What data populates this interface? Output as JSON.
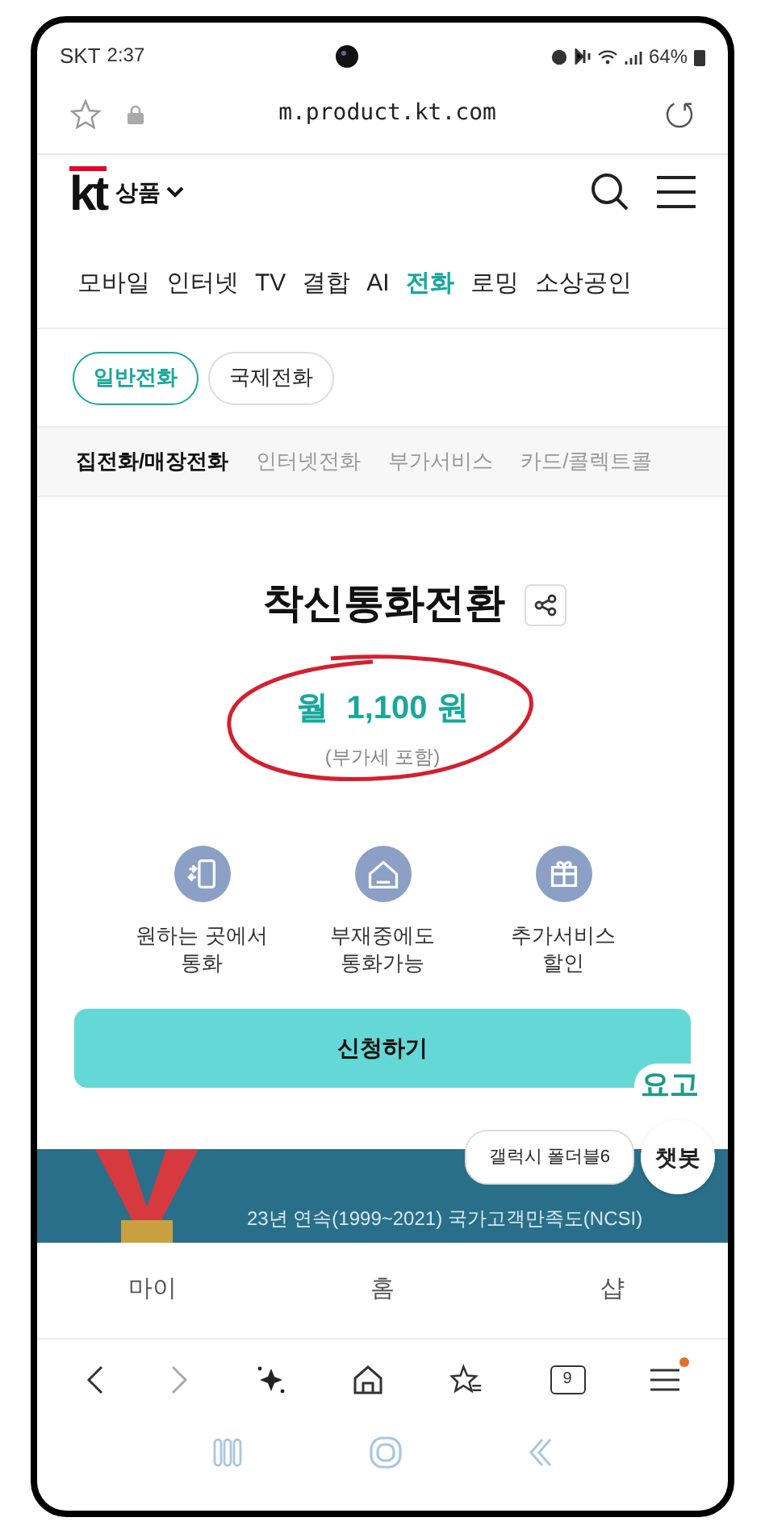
{
  "status_bar": {
    "carrier": "SKT",
    "time": "2:37",
    "battery": "64%"
  },
  "address_bar": {
    "url": "m.product.kt.com"
  },
  "header": {
    "logo": "kt",
    "menu_label": "상품"
  },
  "categories": [
    {
      "label": "모바일",
      "selected": false
    },
    {
      "label": "인터넷",
      "selected": false
    },
    {
      "label": "TV",
      "selected": false
    },
    {
      "label": "결합",
      "selected": false
    },
    {
      "label": "AI",
      "selected": false
    },
    {
      "label": "전화",
      "selected": true
    },
    {
      "label": "로밍",
      "selected": false
    },
    {
      "label": "소상공인",
      "selected": false
    }
  ],
  "chips": [
    {
      "label": "일반전화",
      "selected": true
    },
    {
      "label": "국제전화",
      "selected": false
    }
  ],
  "sub_tabs": [
    {
      "label": "집전화/매장전화",
      "selected": true
    },
    {
      "label": "인터넷전화",
      "selected": false
    },
    {
      "label": "부가서비스",
      "selected": false
    },
    {
      "label": "카드/콜렉트콜",
      "selected": false
    }
  ],
  "product": {
    "title": "착신통화전환",
    "price": "월  1,100 원",
    "price_note": "(부가세 포함)"
  },
  "features": [
    {
      "kind": "phone",
      "lines": [
        "원하는 곳에서",
        "통화"
      ]
    },
    {
      "kind": "house",
      "lines": [
        "부재중에도",
        "통화가능"
      ]
    },
    {
      "kind": "gift",
      "lines": [
        "추가서비스",
        "할인"
      ]
    }
  ],
  "apply_button": "신청하기",
  "badge": "요고",
  "banner": {
    "line": "23년 연속(1999~2021) 국가고객만족도(NCSI)"
  },
  "chatbot": {
    "tooltip": "갤럭시 폴더블6",
    "label": "챗봇"
  },
  "bottom_nav": [
    "마이",
    "홈",
    "샵"
  ],
  "browser_toolbar": {
    "tabs_count": "9"
  }
}
